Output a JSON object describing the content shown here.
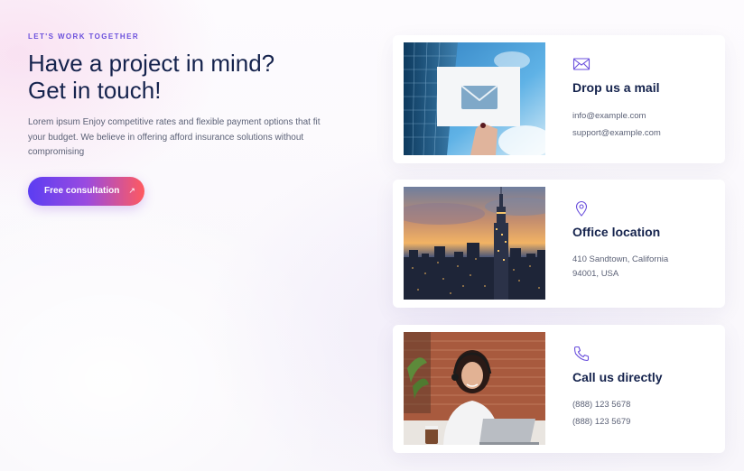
{
  "hero": {
    "eyebrow": "LET'S WORK TOGETHER",
    "title_line1": "Have a project in mind?",
    "title_line2": "Get in touch!",
    "description": "Lorem ipsum Enjoy competitive rates and flexible payment options that fit  your budget. We believe in offering afford insurance solutions without compromising",
    "cta_label": "Free consultation",
    "cta_arrow": "↗"
  },
  "cards": [
    {
      "icon": "mail-icon",
      "title": "Drop us a mail",
      "lines": [
        "info@example.com",
        "support@example.com"
      ]
    },
    {
      "icon": "location-pin-icon",
      "title": "Office location",
      "lines": [
        "410 Sandtown, California",
        "94001, USA"
      ]
    },
    {
      "icon": "phone-icon",
      "title": "Call us directly",
      "lines": [
        "(888) 123 5678",
        "(888) 123 5679"
      ]
    }
  ],
  "colors": {
    "accent": "#6a4fdc",
    "heading": "#15234d",
    "body_text": "#5c6277",
    "cta_gradient_start": "#5b3df2",
    "cta_gradient_end": "#ff5a5f"
  }
}
